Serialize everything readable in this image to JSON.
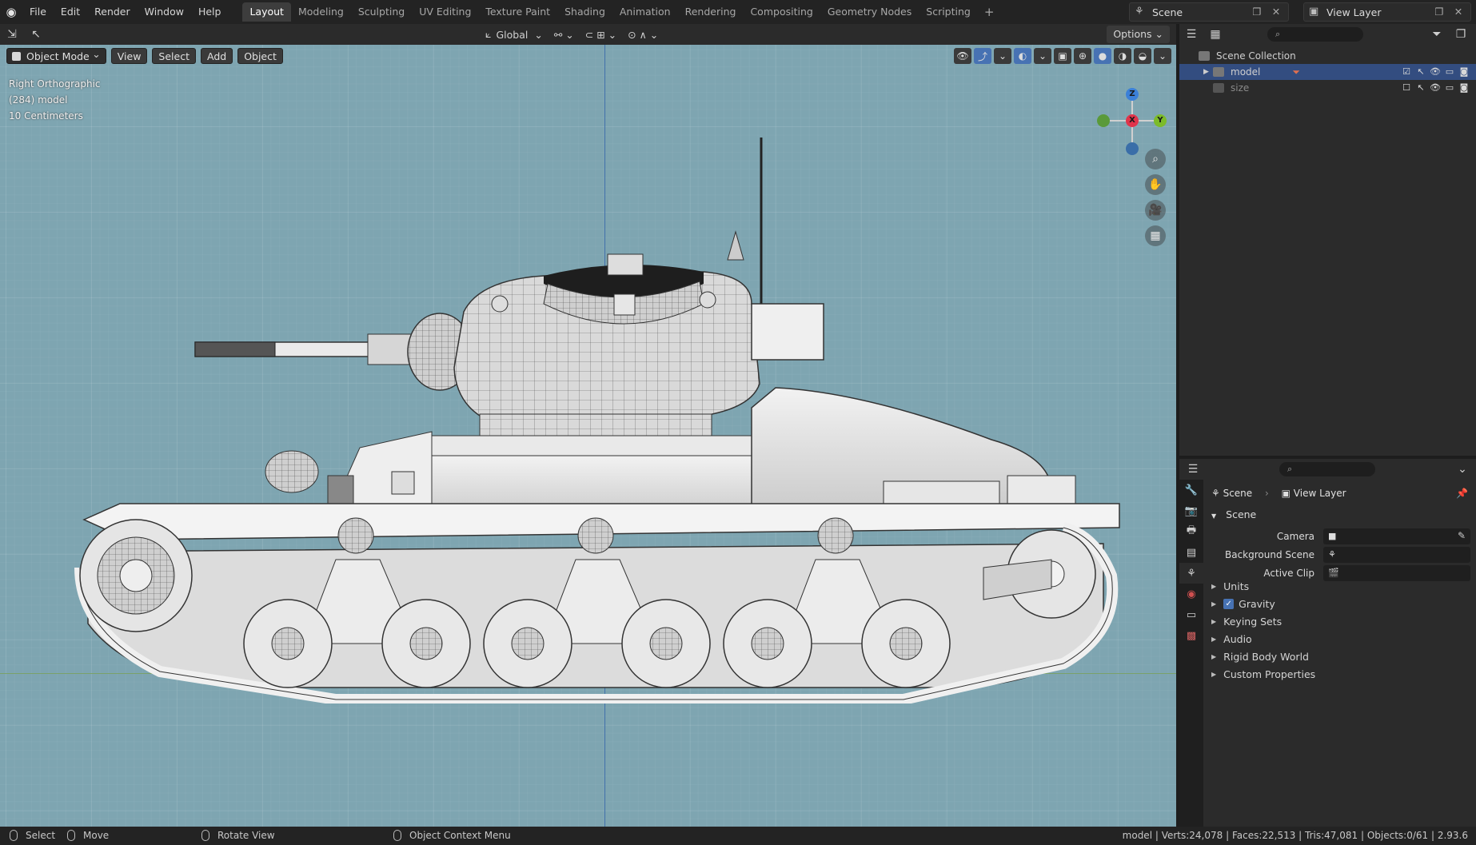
{
  "menu": [
    "File",
    "Edit",
    "Render",
    "Window",
    "Help"
  ],
  "workspaces": [
    "Layout",
    "Modeling",
    "Sculpting",
    "UV Editing",
    "Texture Paint",
    "Shading",
    "Animation",
    "Rendering",
    "Compositing",
    "Geometry Nodes",
    "Scripting"
  ],
  "workspace_add": "+",
  "scene_name": "Scene",
  "view_layer_name": "View Layer",
  "viewport": {
    "transform_orientation": "Global",
    "options_label": "Options",
    "mode": "Object Mode",
    "header_menus": [
      "View",
      "Select",
      "Add",
      "Object"
    ],
    "info": {
      "view_name": "Right Orthographic",
      "object_info": "(284) model",
      "grid_scale": "10 Centimeters"
    },
    "gizmo": {
      "z": "Z",
      "x": "X",
      "y": "Y"
    }
  },
  "outliner": {
    "root": "Scene Collection",
    "items": [
      {
        "name": "model",
        "selected": true,
        "checked": true
      },
      {
        "name": "size",
        "selected": false,
        "checked": false
      }
    ]
  },
  "properties": {
    "breadcrumb": [
      "Scene",
      "View Layer"
    ],
    "panel_title": "Scene",
    "fields": [
      {
        "label": "Camera"
      },
      {
        "label": "Background Scene"
      },
      {
        "label": "Active Clip"
      }
    ],
    "subpanels": [
      "Units",
      "Gravity",
      "Keying Sets",
      "Audio",
      "Rigid Body World",
      "Custom Properties"
    ]
  },
  "statusbar": {
    "select": "Select",
    "move": "Move",
    "rotate": "Rotate View",
    "context": "Object Context Menu",
    "stats": "model | Verts:24,078 | Faces:22,513 | Tris:47,081 | Objects:0/61 | 2.93.6"
  },
  "colors": {
    "viewport_bg": "#7ea5b1",
    "accent_blue": "#4772b3",
    "axis_x": "#e0344b",
    "axis_y": "#7cbb2a",
    "axis_z": "#3b80d8"
  }
}
